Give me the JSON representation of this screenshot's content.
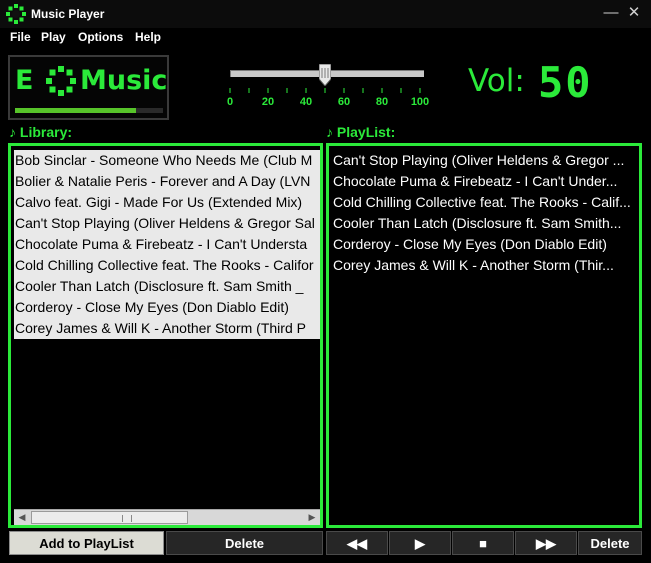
{
  "window": {
    "title": "Music Player",
    "minimize_glyph": "—",
    "close_glyph": "✕"
  },
  "menu": [
    "File",
    "Play",
    "Options",
    "Help"
  ],
  "logo": {
    "letter_e": "E",
    "text": "Music",
    "progress_fraction": 0.82
  },
  "volume": {
    "label": "Vol:",
    "value": "50",
    "slider_value": 50,
    "slider_min": 0,
    "slider_max": 100,
    "ticks": [
      "0",
      "20",
      "40",
      "60",
      "80",
      "100"
    ]
  },
  "library": {
    "label": "Library:",
    "tracks": [
      "Bob Sinclar - Someone Who Needs Me (Club M",
      "Bolier & Natalie Peris - Forever and A Day (LVN",
      "Calvo feat. Gigi - Made For Us (Extended Mix)",
      "Can't Stop Playing (Oliver Heldens & Gregor Sal",
      "Chocolate Puma & Firebeatz - I Can't Understa",
      "Cold Chilling Collective feat. The Rooks - Califor",
      "Cooler Than Latch (Disclosure ft. Sam Smith _",
      "Corderoy - Close My Eyes (Don Diablo Edit)",
      "Corey James & Will K - Another Storm (Third P"
    ]
  },
  "playlist": {
    "label": "PlayList:",
    "tracks": [
      "Can't Stop Playing (Oliver Heldens & Gregor ...",
      "Chocolate Puma & Firebeatz - I Can't Under...",
      "Cold Chilling Collective feat. The Rooks - Calif...",
      "Cooler Than Latch (Disclosure ft. Sam Smith...",
      "Corderoy - Close My Eyes (Don Diablo Edit)",
      "Corey James & Will K - Another Storm (Thir..."
    ]
  },
  "buttons": {
    "add_to_playlist": "Add to PlayList",
    "delete_library": "Delete",
    "previous": "◀◀",
    "play": "▶",
    "stop": "■",
    "next": "▶▶",
    "delete_playlist": "Delete"
  },
  "colors": {
    "accent": "#2bea3a",
    "background": "#000000"
  },
  "icons": {
    "app": "gear-icon",
    "music_note": "music-note-icon"
  }
}
